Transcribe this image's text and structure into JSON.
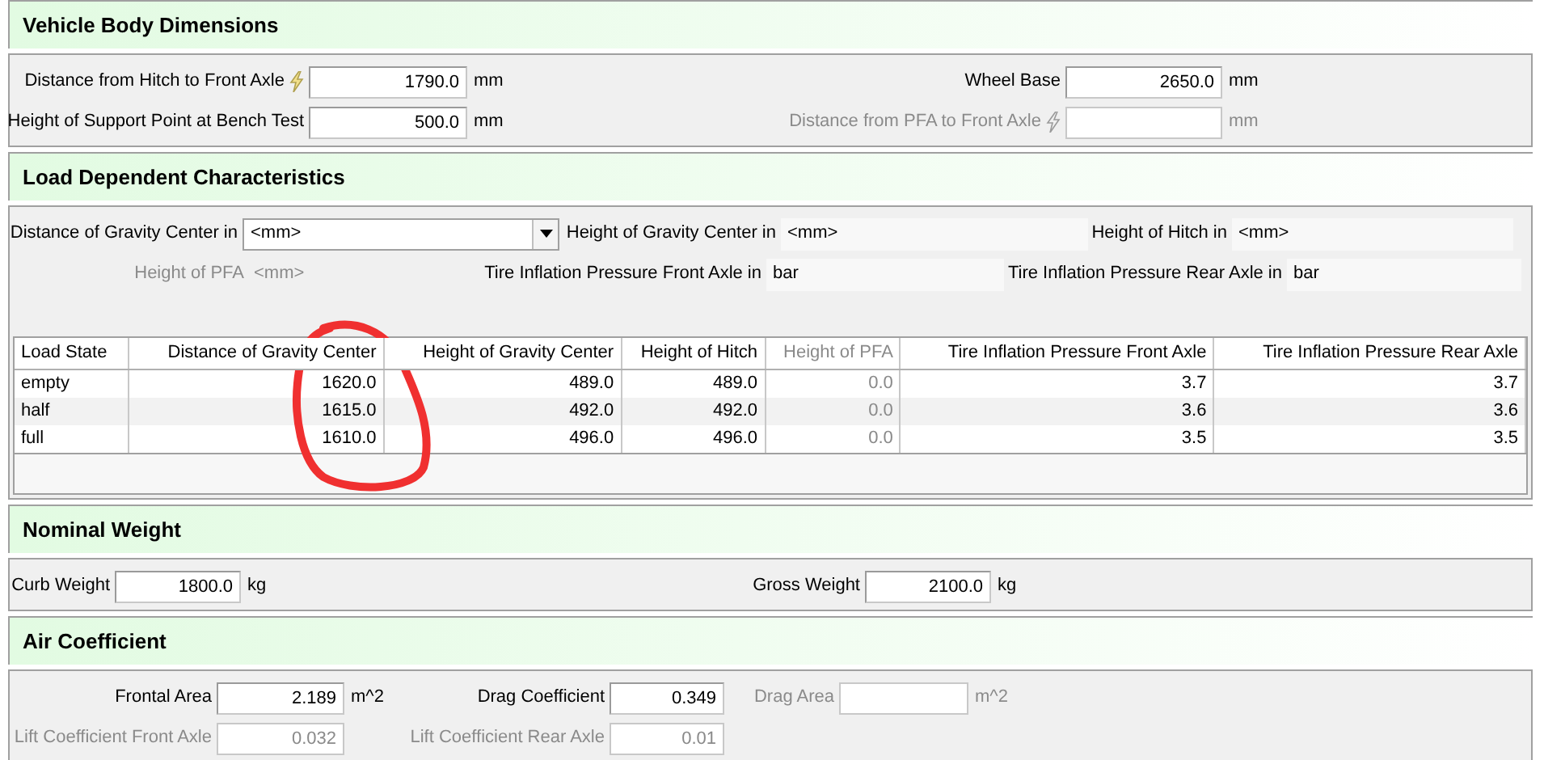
{
  "body_dimensions": {
    "title": "Vehicle Body Dimensions",
    "fields": [
      {
        "label": "Distance from Hitch to Front Axle",
        "value": "1790.0",
        "unit": "mm",
        "disabled": false,
        "linked": true
      },
      {
        "label": "Wheel Base",
        "value": "2650.0",
        "unit": "mm",
        "disabled": false,
        "linked": false
      },
      {
        "label": "Height of Support Point at Bench Test",
        "value": "500.0",
        "unit": "mm",
        "disabled": false,
        "linked": false
      },
      {
        "label": "Distance from PFA to Front Axle",
        "unit": "mm",
        "disabled": true,
        "linked": true
      }
    ]
  },
  "load_dependent": {
    "title": "Load Dependent Characteristics",
    "unit_selectors": [
      {
        "label": "Distance of Gravity Center in",
        "value": "<mm>",
        "kind": "dropdown",
        "disabled": false
      },
      {
        "label": "Height of Gravity Center in",
        "value": "<mm>",
        "kind": "box",
        "disabled": false
      },
      {
        "label": "Height of Hitch in",
        "value": "<mm>",
        "kind": "box",
        "disabled": false
      },
      {
        "label": "Height of PFA",
        "value": "<mm>",
        "kind": "plain",
        "disabled": true
      },
      {
        "label": "Tire Inflation Pressure Front Axle in",
        "value": "bar",
        "kind": "box",
        "disabled": false
      },
      {
        "label": "Tire Inflation Pressure Rear Axle in",
        "value": "bar",
        "kind": "box",
        "disabled": false
      }
    ],
    "table": {
      "columns": [
        {
          "label": "Load State",
          "disabled": false
        },
        {
          "label": "Distance of Gravity Center",
          "disabled": false
        },
        {
          "label": "Height of Gravity Center",
          "disabled": false
        },
        {
          "label": "Height of Hitch",
          "disabled": false
        },
        {
          "label": "Height of PFA",
          "disabled": true
        },
        {
          "label": "Tire Inflation Pressure Front Axle",
          "disabled": false
        },
        {
          "label": "Tire Inflation Pressure Rear Axle",
          "disabled": false
        }
      ],
      "rows": [
        {
          "cells": [
            "empty",
            "1620.0",
            "489.0",
            "489.0",
            "0.0",
            "3.7",
            "3.7"
          ]
        },
        {
          "cells": [
            "half",
            "1615.0",
            "492.0",
            "492.0",
            "0.0",
            "3.6",
            "3.6"
          ]
        },
        {
          "cells": [
            "full",
            "1610.0",
            "496.0",
            "496.0",
            "0.0",
            "3.5",
            "3.5"
          ]
        }
      ]
    }
  },
  "nominal_weight": {
    "title": "Nominal Weight",
    "fields": [
      {
        "label": "Curb Weight",
        "value": "1800.0",
        "unit": "kg",
        "disabled": false
      },
      {
        "label": "Gross Weight",
        "value": "2100.0",
        "unit": "kg",
        "disabled": false
      }
    ]
  },
  "air_coefficient": {
    "title": "Air Coefficient",
    "fields": [
      {
        "label": "Frontal Area",
        "value": "2.189",
        "unit": "m^2",
        "disabled": false
      },
      {
        "label": "Drag Coefficient",
        "value": "0.349",
        "disabled": false
      },
      {
        "label": "Drag Area",
        "unit": "m^2",
        "disabled": true
      },
      {
        "label": "Lift Coefficient Front Axle",
        "value": "0.032",
        "disabled": true
      },
      {
        "label": "Lift Coefficient Rear Axle",
        "value": "0.01",
        "disabled": true
      }
    ]
  }
}
